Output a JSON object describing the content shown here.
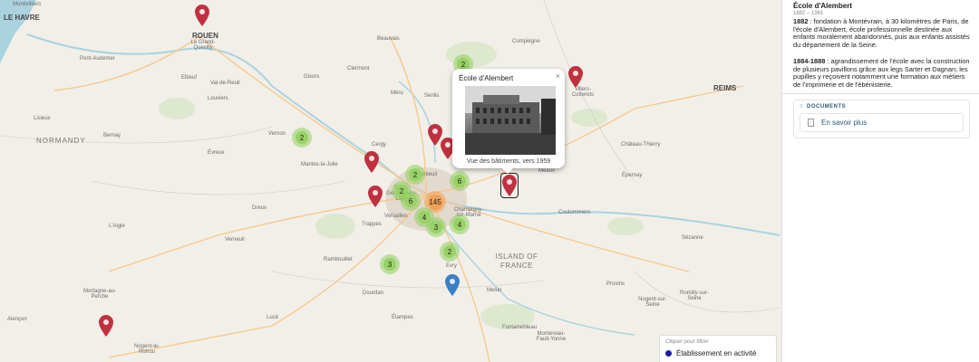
{
  "map": {
    "places": [
      {
        "text": "Montivilliers",
        "cls": ""
      },
      {
        "text": "LE HAVRE",
        "cls": "big"
      },
      {
        "text": "ROUEN",
        "cls": "big"
      },
      {
        "text": "Le Grand-Quevilly",
        "cls": ""
      },
      {
        "text": "Pont-Audemer",
        "cls": ""
      },
      {
        "text": "Elbeuf",
        "cls": ""
      },
      {
        "text": "Val-de-Reuil",
        "cls": ""
      },
      {
        "text": "Louviers",
        "cls": ""
      },
      {
        "text": "Gisors",
        "cls": ""
      },
      {
        "text": "Beauvais",
        "cls": ""
      },
      {
        "text": "Clermont",
        "cls": ""
      },
      {
        "text": "Compiègne",
        "cls": ""
      },
      {
        "text": "Méru",
        "cls": ""
      },
      {
        "text": "Senlis",
        "cls": ""
      },
      {
        "text": "Villers-Cotterets",
        "cls": ""
      },
      {
        "text": "REIMS",
        "cls": "big"
      },
      {
        "text": "Lisieux",
        "cls": ""
      },
      {
        "text": "NORMANDY",
        "cls": "region"
      },
      {
        "text": "Bernay",
        "cls": ""
      },
      {
        "text": "Vernon",
        "cls": ""
      },
      {
        "text": "Évreux",
        "cls": ""
      },
      {
        "text": "Cergy",
        "cls": ""
      },
      {
        "text": "Mantes-la-Jolie",
        "cls": ""
      },
      {
        "text": "Argenteuil",
        "cls": ""
      },
      {
        "text": "Saint-Germain-en-Laye",
        "cls": ""
      },
      {
        "text": "Versailles",
        "cls": ""
      },
      {
        "text": "Trappes",
        "cls": ""
      },
      {
        "text": "Champigny-sur-Marne",
        "cls": ""
      },
      {
        "text": "Meaux",
        "cls": ""
      },
      {
        "text": "Château-Thierry",
        "cls": ""
      },
      {
        "text": "Épernay",
        "cls": ""
      },
      {
        "text": "Coulommiers",
        "cls": ""
      },
      {
        "text": "L'Aigle",
        "cls": ""
      },
      {
        "text": "Dreux",
        "cls": ""
      },
      {
        "text": "Verneuil",
        "cls": ""
      },
      {
        "text": "Rambouillet",
        "cls": ""
      },
      {
        "text": "ISLAND OF FRANCE",
        "cls": "dept"
      },
      {
        "text": "Evry",
        "cls": ""
      },
      {
        "text": "Melun",
        "cls": ""
      },
      {
        "text": "Provins",
        "cls": ""
      },
      {
        "text": "Sézanne",
        "cls": ""
      },
      {
        "text": "Dourdan",
        "cls": ""
      },
      {
        "text": "Nogent-sur-Seine",
        "cls": ""
      },
      {
        "text": "Romilly-sur-Seine",
        "cls": ""
      },
      {
        "text": "Mortagne-au-Perche",
        "cls": ""
      },
      {
        "text": "Alençon",
        "cls": ""
      },
      {
        "text": "Lucé",
        "cls": ""
      },
      {
        "text": "Étampes",
        "cls": ""
      },
      {
        "text": "Fontainebleau",
        "cls": ""
      },
      {
        "text": "Montereau-Fault-Yonne",
        "cls": ""
      },
      {
        "text": "Nogent-le-Rotrou",
        "cls": ""
      }
    ],
    "clusters": [
      {
        "count": "2",
        "color": "green"
      },
      {
        "count": "2",
        "color": "green"
      },
      {
        "count": "2",
        "color": "green"
      },
      {
        "count": "2",
        "color": "green"
      },
      {
        "count": "6",
        "color": "green"
      },
      {
        "count": "6",
        "color": "green"
      },
      {
        "count": "145",
        "color": "orange"
      },
      {
        "count": "4",
        "color": "green"
      },
      {
        "count": "3",
        "color": "green"
      },
      {
        "count": "4",
        "color": "green"
      },
      {
        "count": "2",
        "color": "green"
      },
      {
        "count": "3",
        "color": "green"
      }
    ],
    "markers": [
      {
        "color": "#c0303f"
      },
      {
        "color": "#c0303f"
      },
      {
        "color": "#c0303f"
      },
      {
        "color": "#c0303f"
      },
      {
        "color": "#c0303f"
      },
      {
        "color": "#c0303f"
      },
      {
        "color": "#c0303f"
      },
      {
        "color": "#c0303f"
      },
      {
        "color": "#3a80c4"
      }
    ],
    "popup": {
      "title": "École d'Alembert",
      "close": "×",
      "caption": "Vue des bâtiments, vers 1959"
    },
    "legend": {
      "hint": "Cliquer pour filtrer",
      "item": "Établissement en activité",
      "dot_color": "#1a1aa8"
    }
  },
  "panel": {
    "name": "École d'Alembert",
    "dates": "1882 – 1961",
    "p1_year": "1882",
    "p1_text": " : fondation à Montévrain, à 30 kilomètres de Paris, de l'école d'Alembert, école professionnelle destinée aux enfants moralement abandonnés, puis aux enfants assistés du département de la Seine.",
    "p2_year": "1884-1888",
    "p2_text": " : agrandissement de l'école avec la construction de plusieurs pavillons grâce aux legs Sarter et Dagnan; les pupilles y reçoivent notamment une formation aux métiers de l'imprimerie et de l'ébénisterie.",
    "docs_title": "DOCUMENTS",
    "doc_link": "En savoir plus"
  }
}
